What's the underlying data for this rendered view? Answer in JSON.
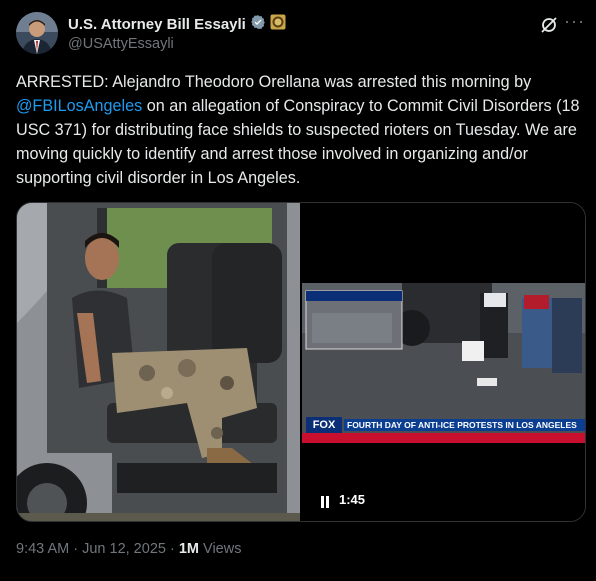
{
  "author": {
    "name": "U.S. Attorney Bill Essayli",
    "handle": "@USAttyEssayli"
  },
  "tweet": {
    "text_before_mention": "ARRESTED: Alejandro Theodoro Orellana was arrested this morning by ",
    "mention": "@FBILosAngeles",
    "text_after_mention": " on an allegation of Conspiracy to Commit Civil Disorders (18 USC 371) for distributing face shields to suspected rioters on Tuesday. We are moving quickly to identify and arrest those involved in organizing and/or supporting civil disorder in Los Angeles."
  },
  "video": {
    "network": "FOX",
    "headline": "FOURTH DAY OF ANTI-ICE PROTESTS IN LOS ANGELES",
    "duration": "1:45"
  },
  "meta": {
    "time": "9:43 AM",
    "separator1": " · ",
    "date": "Jun 12, 2025",
    "separator2": " · ",
    "views_count": "1M",
    "views_label": " Views"
  },
  "icons": {
    "verified": "verified-badge-icon",
    "seal": "doj-seal-icon",
    "grok": "grok-icon",
    "more": "more-options-icon",
    "pause": "pause-icon"
  },
  "colors": {
    "link": "#1d9bf0",
    "secondary_text": "#71767b",
    "background": "#000000",
    "fox_banner": "#0b3d91",
    "ticker": "#c8102e"
  }
}
